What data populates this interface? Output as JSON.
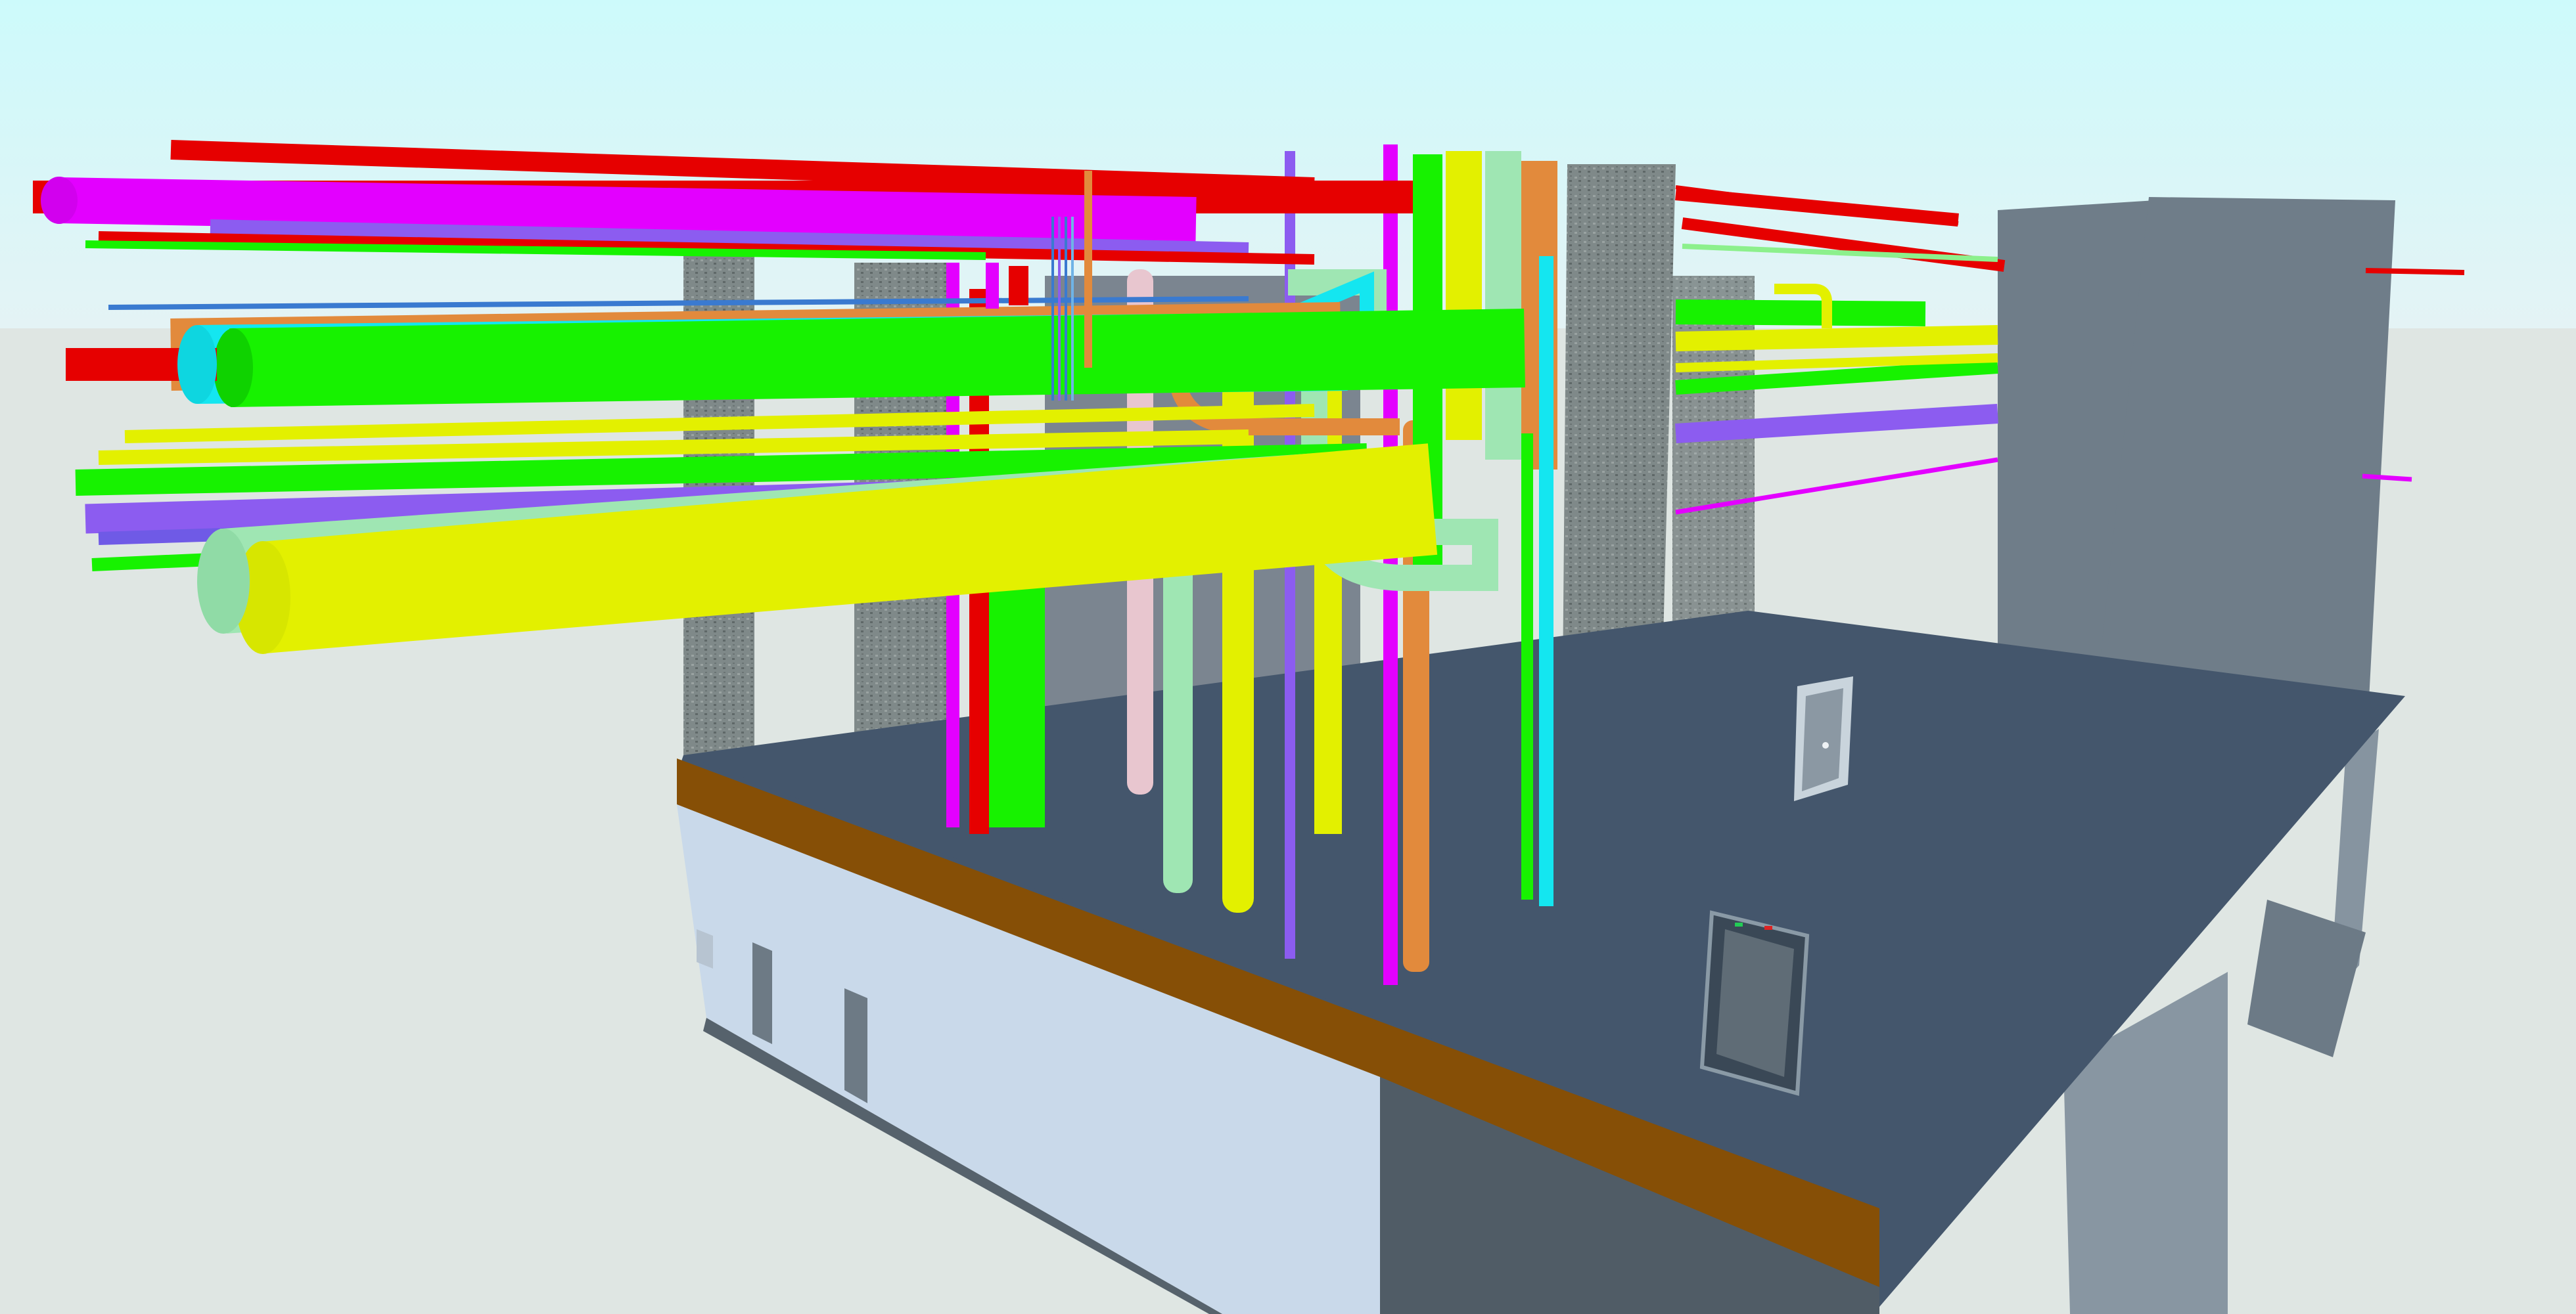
{
  "scene": {
    "view": "3d-bim-model",
    "colors": {
      "sky_top": "#cdfafb",
      "sky_bottom": "#e4f3f5",
      "ground": "#dfe6e3",
      "floor_slab": "#44566c",
      "slab_edge_band": "#864f06",
      "exterior_wall": "#c9d9ea",
      "building_block": "#6f7d89",
      "column": "#7d8787",
      "pipe_red": "#e60000",
      "pipe_magenta": "#e300ff",
      "pipe_green": "#17f200",
      "pipe_yellow": "#e3f000",
      "pipe_mint": "#9fe6b3",
      "pipe_cyan": "#14e6f0",
      "pipe_orange": "#e28a3c",
      "pipe_violet": "#8c5cf0",
      "pipe_pink": "#e8c6cf"
    },
    "icons": {
      "door": "door-icon",
      "floor-hatch": "floor-hatch-icon"
    }
  }
}
